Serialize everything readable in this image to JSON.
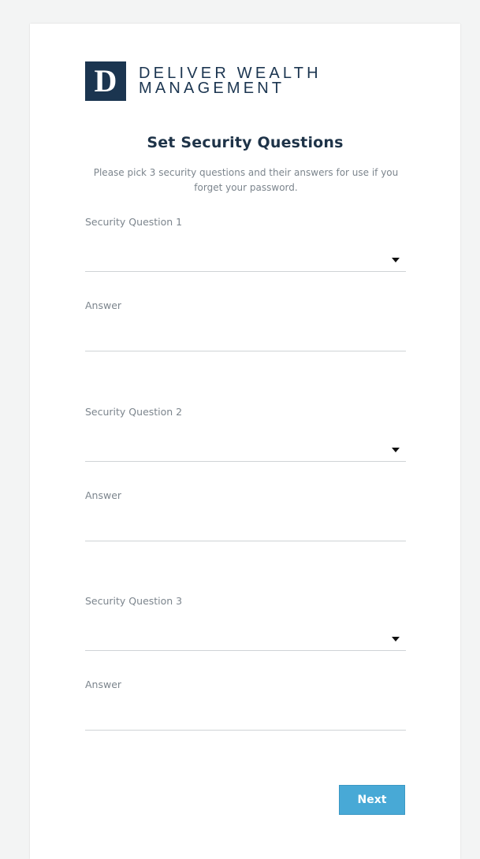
{
  "brand": {
    "logo_letter": "D",
    "name_line1": "DELIVER WEALTH",
    "name_line2": "MANAGEMENT",
    "color": "#1b3550"
  },
  "page": {
    "title": "Set Security Questions",
    "subtitle": "Please pick 3 security questions and their answers for use if you forget your password."
  },
  "questions": [
    {
      "question_label": "Security Question 1",
      "question_value": "",
      "answer_label": "Answer",
      "answer_value": ""
    },
    {
      "question_label": "Security Question 2",
      "question_value": "",
      "answer_label": "Answer",
      "answer_value": ""
    },
    {
      "question_label": "Security Question 3",
      "question_value": "",
      "answer_label": "Answer",
      "answer_value": ""
    }
  ],
  "actions": {
    "next_label": "Next",
    "accent": "#48a9d6"
  },
  "icons": {
    "dropdown": "chevron-down-icon"
  }
}
